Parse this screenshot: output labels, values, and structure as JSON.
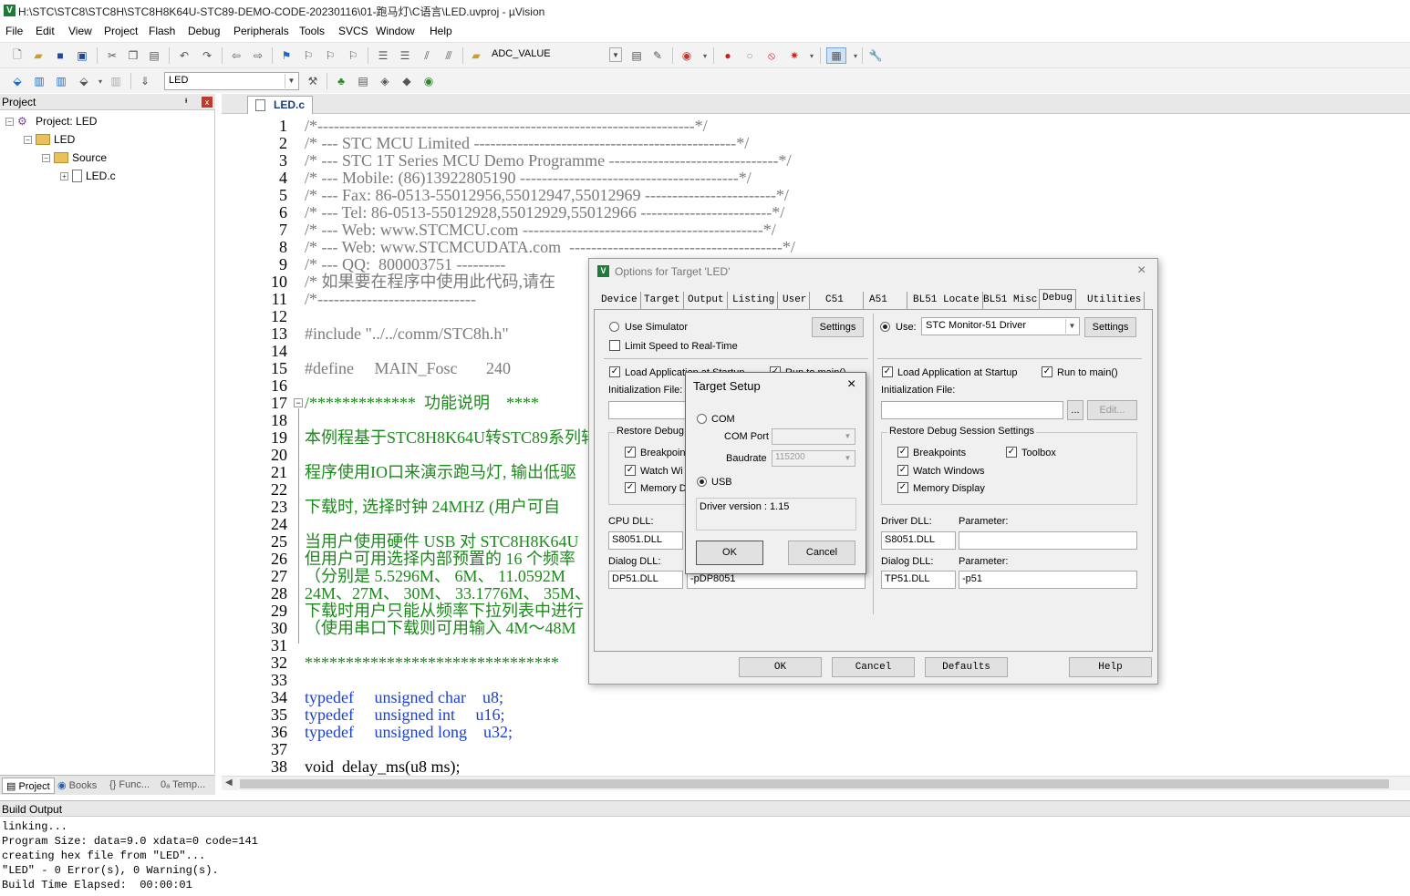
{
  "window": {
    "title": "H:\\STC\\STC8\\STC8H\\STC8H8K64U-STC89-DEMO-CODE-20230116\\01-跑马灯\\C语言\\LED.uvproj - µVision",
    "app_icon": "V"
  },
  "menu": [
    "File",
    "Edit",
    "View",
    "Project",
    "Flash",
    "Debug",
    "Peripherals",
    "Tools",
    "SVCS",
    "Window",
    "Help"
  ],
  "toolbar1": {
    "combo_value": "ADC_VALUE"
  },
  "toolbar2": {
    "target_value": "LED"
  },
  "project_panel": {
    "title": "Project",
    "pin": "ᵻ",
    "close": "x",
    "tree": {
      "root": "Project: LED",
      "group": "LED",
      "subgroup": "Source",
      "file": "LED.c"
    },
    "tabs": [
      "Project",
      "Books",
      "{} Func...",
      "0ₐ Temp..."
    ]
  },
  "editor": {
    "tab": "LED.c",
    "lines": [
      {
        "n": "1",
        "text": "/*---------------------------------------------------------------------*/"
      },
      {
        "n": "2",
        "text": "/* --- STC MCU Limited ------------------------------------------------*/"
      },
      {
        "n": "3",
        "text": "/* --- STC 1T Series MCU Demo Programme -------------------------------*/"
      },
      {
        "n": "4",
        "text": "/* --- Mobile: (86)13922805190 ----------------------------------------*/"
      },
      {
        "n": "5",
        "text": "/* --- Fax: 86-0513-55012956,55012947,55012969 ------------------------*/"
      },
      {
        "n": "6",
        "text": "/* --- Tel: 86-0513-55012928,55012929,55012966 ------------------------*/"
      },
      {
        "n": "7",
        "text": "/* --- Web: www.STCMCU.com --------------------------------------------*/"
      },
      {
        "n": "8",
        "text": "/* --- Web: www.STCMCUDATA.com  ---------------------------------------*/"
      },
      {
        "n": "9",
        "text": "/* --- QQ:  800003751 ---------"
      },
      {
        "n": "10",
        "text": "/* 如果要在程序中使用此代码,请在"
      },
      {
        "n": "11",
        "text": "/*-----------------------------"
      },
      {
        "n": "12",
        "text": ""
      },
      {
        "n": "13",
        "text": "#include \"../../comm/STC8h.h\""
      },
      {
        "n": "14",
        "text": ""
      },
      {
        "n": "15",
        "text": "#define     MAIN_Fosc       240"
      },
      {
        "n": "16",
        "text": ""
      },
      {
        "n": "17",
        "text": "/*************  功能说明    ****"
      },
      {
        "n": "18",
        "text": ""
      },
      {
        "n": "19",
        "text": "本例程基于STC8H8K64U转STC89系列转"
      },
      {
        "n": "20",
        "text": ""
      },
      {
        "n": "21",
        "text": "程序使用IO口来演示跑马灯, 输出低驱"
      },
      {
        "n": "22",
        "text": ""
      },
      {
        "n": "23",
        "text": "下载时, 选择时钟 24MHZ (用户可自"
      },
      {
        "n": "24",
        "text": ""
      },
      {
        "n": "25",
        "text": "当用户使用硬件 USB 对 STC8H8K64U"
      },
      {
        "n": "26",
        "text": "但用户可用选择内部预置的 16 个频率"
      },
      {
        "n": "27",
        "text": "（分别是 5.5296M、 6M、 11.0592M"
      },
      {
        "n": "28",
        "text": "24M、27M、 30M、 33.1776M、 35M、"
      },
      {
        "n": "29",
        "text": "下载时用户只能从频率下拉列表中进行"
      },
      {
        "n": "30",
        "text": "（使用串口下载则可用输入 4M～48M"
      },
      {
        "n": "31",
        "text": ""
      },
      {
        "n": "32",
        "text": "*******************************"
      },
      {
        "n": "33",
        "text": ""
      },
      {
        "n": "34",
        "text": "typedef     unsigned char    u8;"
      },
      {
        "n": "35",
        "text": "typedef     unsigned int     u16;"
      },
      {
        "n": "36",
        "text": "typedef     unsigned long    u32;"
      },
      {
        "n": "37",
        "text": ""
      },
      {
        "n": "38",
        "text": "void  delay_ms(u8 ms);"
      }
    ]
  },
  "build_output": {
    "title": "Build Output",
    "lines": [
      "linking...",
      "Program Size: data=9.0 xdata=0 code=141",
      "creating hex file from \"LED\"...",
      "\"LED\" - 0 Error(s), 0 Warning(s).",
      "Build Time Elapsed:  00:00:01"
    ]
  },
  "options_dialog": {
    "title": "Options for Target 'LED'",
    "close": "×",
    "tabs": [
      "Device",
      "Target",
      "Output",
      "Listing",
      "User",
      "C51",
      "A51",
      "BL51 Locate",
      "BL51 Misc",
      "Debug",
      "Utilities"
    ],
    "active_tab": "Debug",
    "left": {
      "use_simulator": "Use Simulator",
      "settings": "Settings",
      "limit_speed": "Limit Speed to Real-Time",
      "load_app": "Load Application at Startup",
      "run_to_main": "Run to main()",
      "init_file": "Initialization File:",
      "restore_group": "Restore Debug",
      "breakpoints": "Breakpoint",
      "watch": "Watch Wi",
      "memory": "Memory Di",
      "cpu_dll_label": "CPU DLL:",
      "cpu_dll": "S8051.DLL",
      "dialog_dll_label": "Dialog DLL:",
      "dialog_dll": "DP51.DLL",
      "dialog_param": "-pDP8051"
    },
    "right": {
      "use": "Use:",
      "driver": "STC Monitor-51 Driver",
      "settings": "Settings",
      "load_app": "Load Application at Startup",
      "run_to_main": "Run to main()",
      "init_file": "Initialization File:",
      "browse": "...",
      "edit": "Edit...",
      "restore_group": "Restore Debug Session Settings",
      "breakpoints": "Breakpoints",
      "toolbox": "Toolbox",
      "watch": "Watch Windows",
      "memory": "Memory Display",
      "driver_dll_label": "Driver DLL:",
      "driver_dll": "S8051.DLL",
      "parameter_label": "Parameter:",
      "driver_param": "",
      "dialog_dll_label": "Dialog DLL:",
      "dialog_dll": "TP51.DLL",
      "parameter2_label": "Parameter:",
      "dialog_param": "-p51"
    },
    "buttons": {
      "ok": "OK",
      "cancel": "Cancel",
      "defaults": "Defaults",
      "help": "Help"
    }
  },
  "target_setup": {
    "title": "Target Setup",
    "close": "×",
    "com": "COM",
    "com_port_label": "COM Port",
    "com_port": "",
    "baudrate_label": "Baudrate",
    "baudrate": "115200",
    "usb": "USB",
    "driver_version": "Driver version : 1.15",
    "ok": "OK",
    "cancel": "Cancel"
  }
}
